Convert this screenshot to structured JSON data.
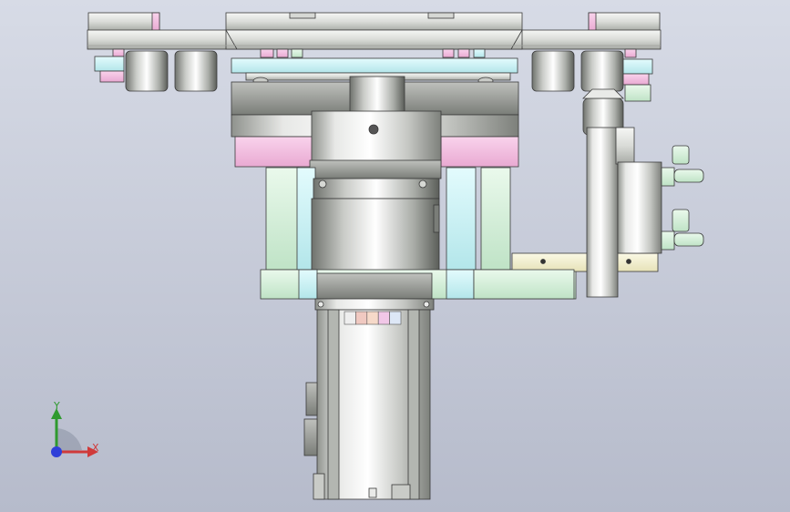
{
  "viewport": {
    "background_top": "#d7dbe6",
    "background_bottom": "#b6bbcb"
  },
  "model": {
    "colors": {
      "metal_light": "#e9eae8",
      "metal_mid": "#c9cbc7",
      "metal_dark": "#8e918c",
      "pink": "#f4c6e3",
      "cyan": "#c8f0f3",
      "mint": "#cdebd2",
      "cream": "#f2efcf",
      "edge": "#3a3a3a"
    },
    "motor_label_segments": [
      "#eeeeee",
      "#f0c9c1",
      "#f6d9c9",
      "#f1c7e7",
      "#dde7f6"
    ]
  },
  "triad": {
    "x_label": "X",
    "y_label": "Y",
    "x_color": "#d03a3a",
    "y_color": "#2f9a2f",
    "z_color": "#2f3fd8"
  }
}
